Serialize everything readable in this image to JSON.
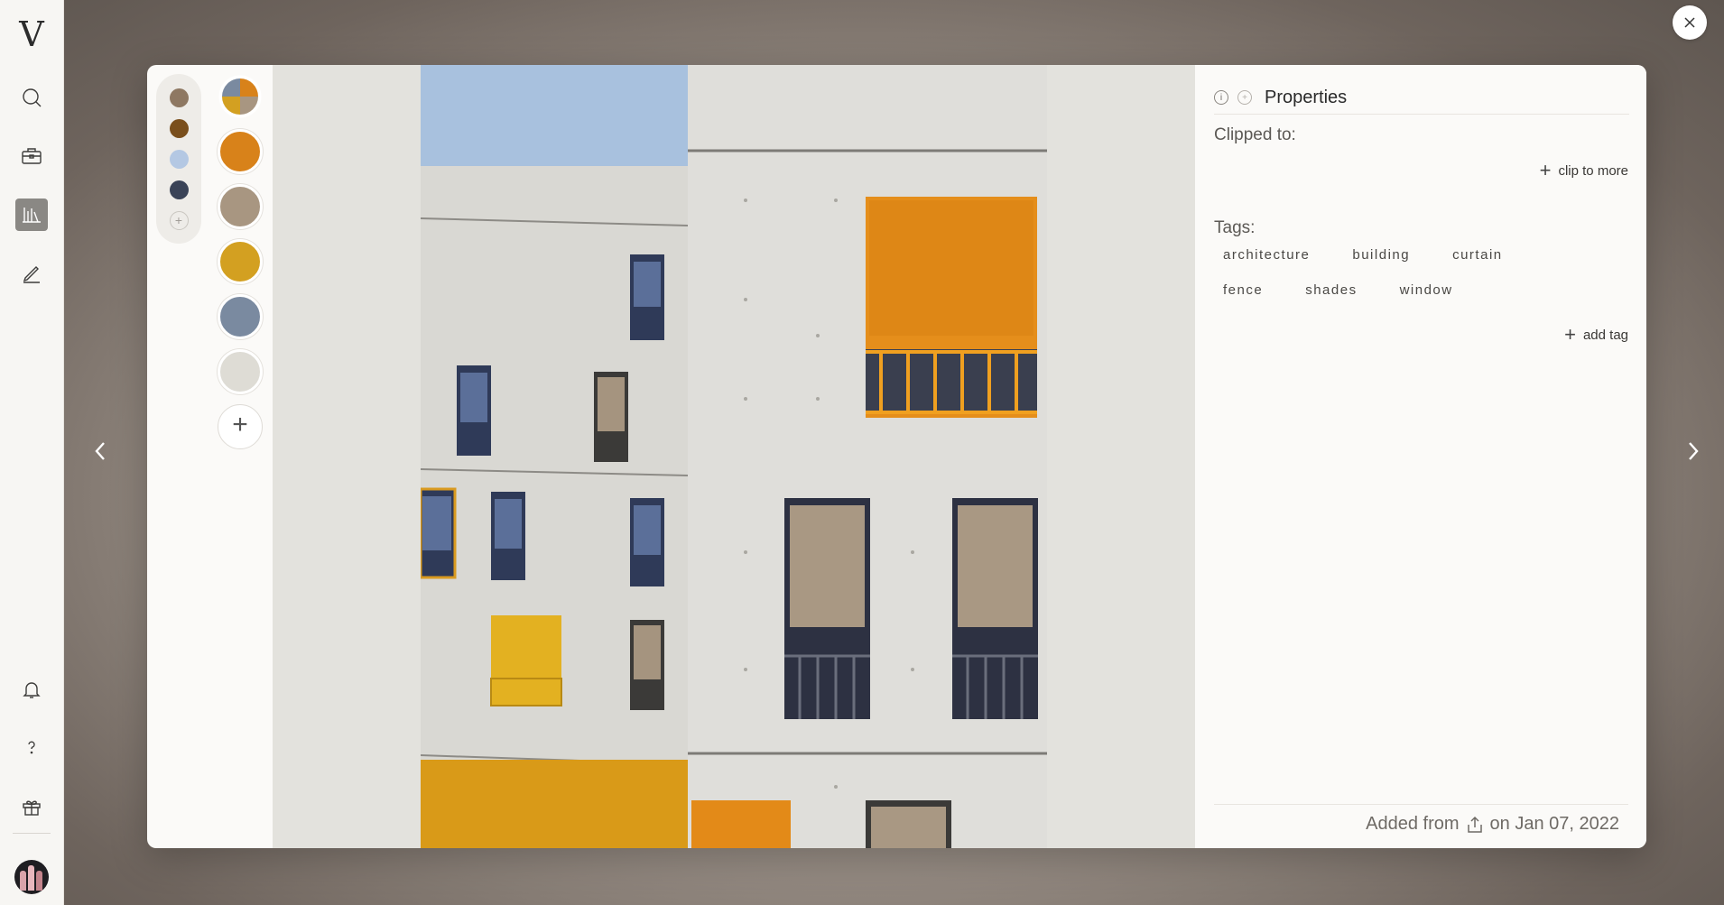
{
  "app": {
    "logo_letter": "V"
  },
  "sidebar": {
    "items": [
      {
        "name": "search",
        "icon": "search-icon"
      },
      {
        "name": "briefcase",
        "icon": "briefcase-icon"
      },
      {
        "name": "library",
        "icon": "library-icon",
        "active": true
      },
      {
        "name": "pen",
        "icon": "pen-icon"
      }
    ],
    "bottom": [
      {
        "name": "notifications",
        "icon": "bell-icon"
      },
      {
        "name": "help",
        "icon": "question-icon"
      },
      {
        "name": "gift",
        "icon": "gift-icon"
      }
    ]
  },
  "palette": {
    "mini_colors": [
      "#8e7862",
      "#7a4f1c",
      "#b4c8e3",
      "#3a4357"
    ],
    "swatches": [
      "#d8821a",
      "#a89681",
      "#d3a021",
      "#7a8aa0",
      "#dedcd5"
    ],
    "pie_colors": [
      "#d8821a",
      "#a89681",
      "#d3a021",
      "#7a8aa0"
    ]
  },
  "panel": {
    "title": "Properties",
    "clipped_label": "Clipped to:",
    "clip_action": "clip to more",
    "tags_label": "Tags:",
    "tags": [
      "architecture",
      "building",
      "curtain",
      "fence",
      "shades",
      "window"
    ],
    "add_tag_action": "add tag",
    "footer_prefix": "Added from",
    "footer_date": "on Jan 07, 2022"
  }
}
